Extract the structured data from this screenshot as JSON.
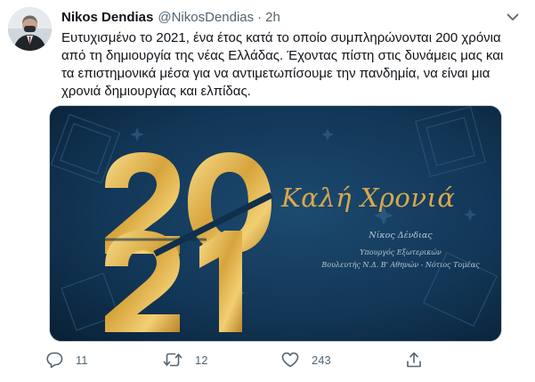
{
  "user": {
    "name": "Nikos Dendias",
    "handle": "@NikosDendias",
    "separator": "·",
    "time": "2h"
  },
  "tweet": {
    "lines": [
      "Ευτυχισμένο το 2021, ένα έτος κατά το οποίο συμπληρώνονται 200 χρόνια",
      "από τη δημιουργία της νέας Ελλάδας. Έχοντας πίστη στις δυνάμεις μας και",
      "τα επιστημονικά μέσα για να αντιμετωπίσουμε την πανδημία, να είναι μια",
      "χρονιά δημιουργίας και ελπίδας."
    ]
  },
  "card": {
    "year_top": "20",
    "year_bottom": "21",
    "greeting": "Καλή Χρονιά",
    "signature_name": "Νίκος Δένδιας",
    "signature_role_1": "Υπουργός Εξωτερικών",
    "signature_role_2": "Βουλευτής Ν.Δ. Β' Αθηνών - Νότιος Τομέας",
    "colors": {
      "background": "#0f2f4c",
      "gold": "#d9a84c",
      "text": "#b7c7d6"
    }
  },
  "actions": {
    "reply_count": "11",
    "retweet_count": "12",
    "like_count": "243"
  },
  "icons": {
    "avatar": "avatar-photo",
    "caret": "chevron-down-icon",
    "reply": "reply-icon",
    "retweet": "retweet-icon",
    "like": "heart-icon",
    "share": "share-icon"
  }
}
